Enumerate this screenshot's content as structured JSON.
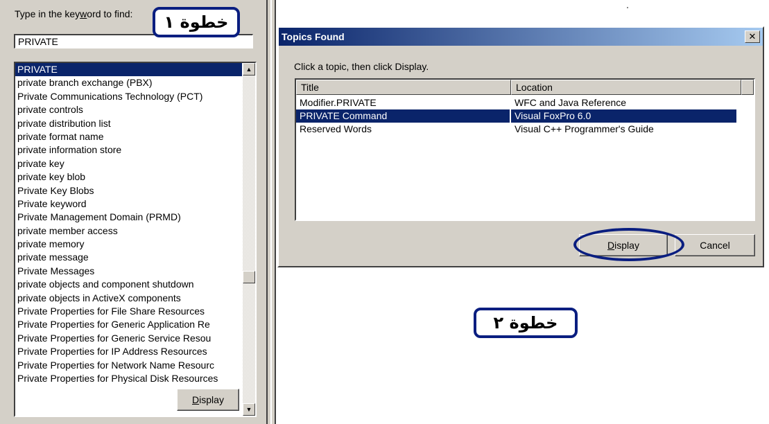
{
  "index_pane": {
    "find_label_pre": "Type in the key",
    "find_label_accel": "w",
    "find_label_post": "ord to find:",
    "keyword_value": "PRIVATE",
    "items": [
      "PRIVATE",
      "private branch exchange (PBX)",
      "Private Communications Technology (PCT)",
      "private controls",
      "private distribution list",
      "private format name",
      "private information store",
      "private key",
      "private key blob",
      "Private Key Blobs",
      "Private keyword",
      "Private Management Domain (PRMD)",
      "private member access",
      "private memory",
      "private message",
      "Private Messages",
      "private objects and component shutdown",
      "private objects in ActiveX components",
      "Private Properties for File Share Resources",
      "Private Properties for Generic Application Re",
      "Private Properties for Generic Service Resou",
      "Private Properties for IP Address Resources",
      "Private Properties for Network Name Resourc",
      "Private Properties for Physical Disk Resources"
    ],
    "selected_index": 0,
    "display_accel": "D",
    "display_rest": "isplay"
  },
  "annotations": {
    "step1": "خطوة ١",
    "step2": "خطوة ٢"
  },
  "dialog": {
    "title": "Topics Found",
    "close_glyph": "✕",
    "instruction": "Click a topic, then click Display.",
    "columns": {
      "title": "Title",
      "location": "Location"
    },
    "rows": [
      {
        "title": "Modifier.PRIVATE",
        "location": "WFC and Java Reference"
      },
      {
        "title": "PRIVATE Command",
        "location": "Visual FoxPro 6.0"
      },
      {
        "title": "Reserved Words",
        "location": "Visual C++ Programmer's Guide"
      }
    ],
    "selected_row": 1,
    "display_accel": "D",
    "display_rest": "isplay",
    "cancel_label": "Cancel"
  },
  "icons": {
    "scroll_up": "▲",
    "scroll_down": "▼"
  },
  "colors": {
    "selection": "#0a246a",
    "annotation": "#0a1e80"
  }
}
